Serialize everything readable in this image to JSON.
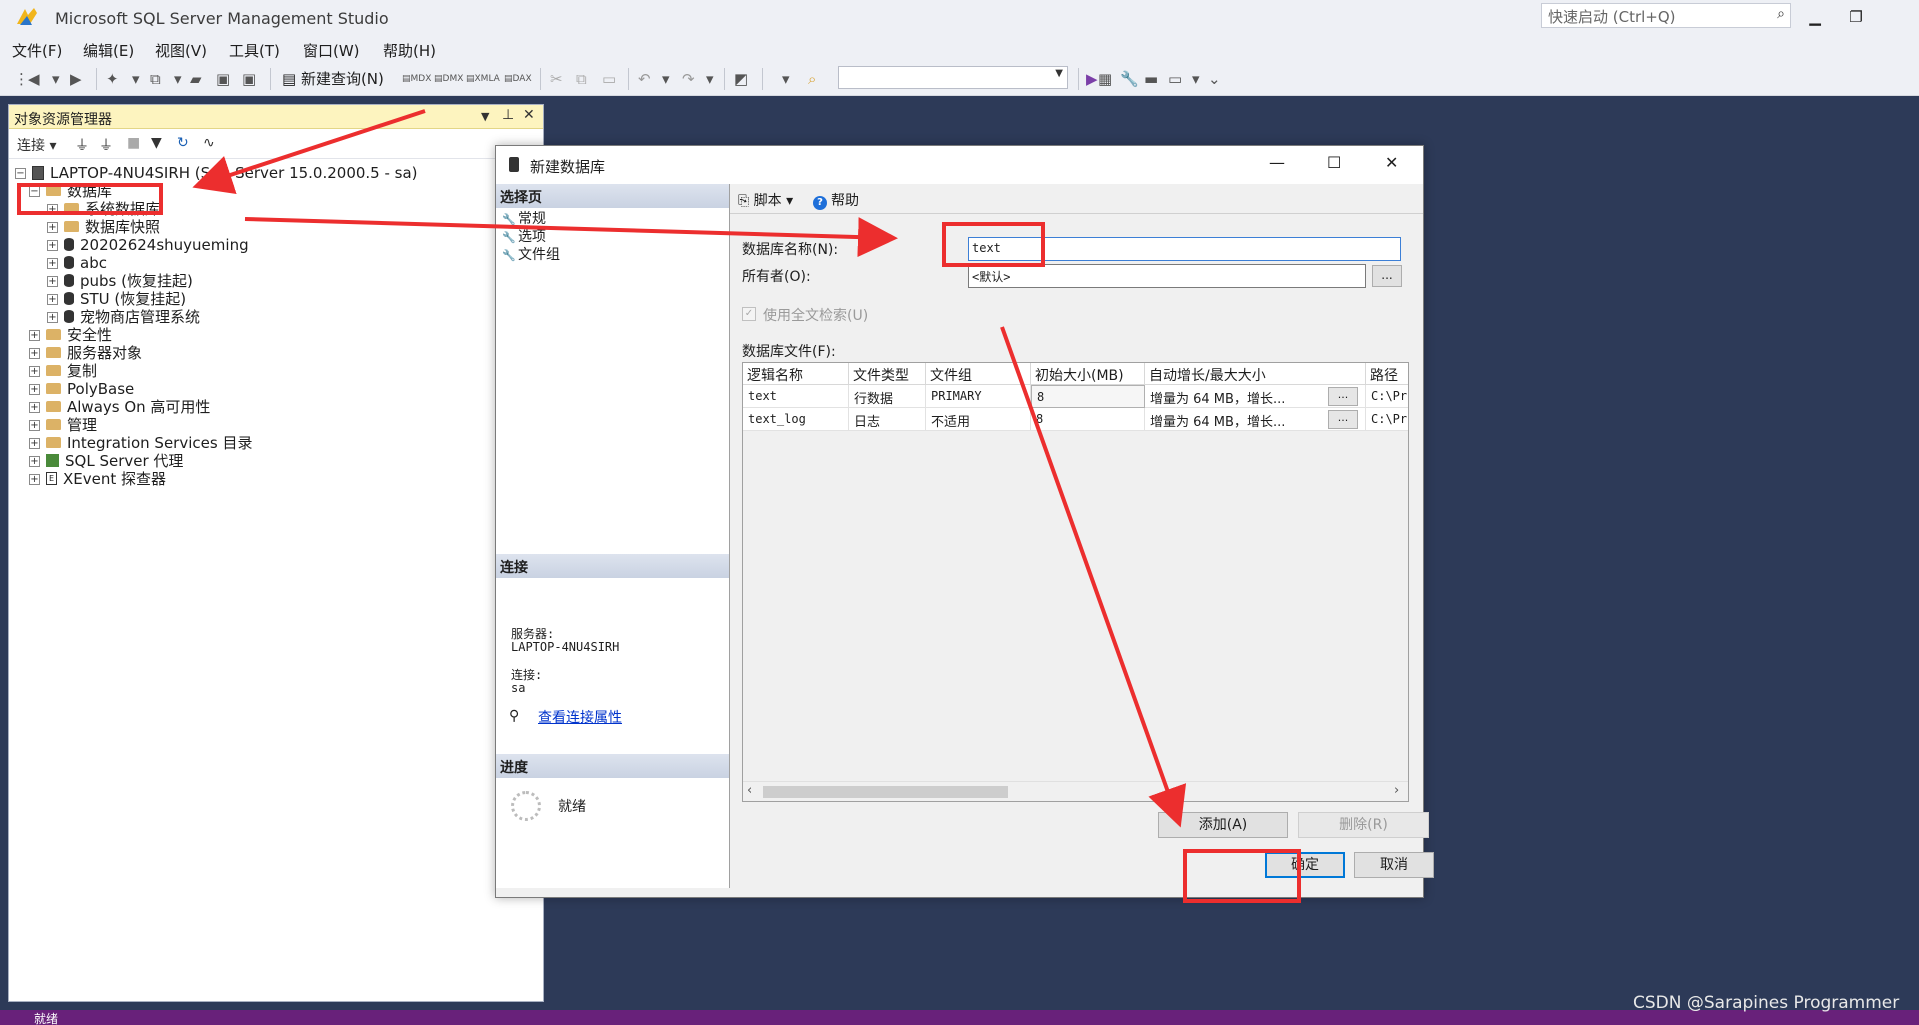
{
  "app": {
    "title": "Microsoft SQL Server Management Studio",
    "quick_launch_placeholder": "快速启动 (Ctrl+Q)",
    "icons": {
      "app": "ssms-app-icon",
      "search": "search-icon",
      "minimize": "minimize-icon",
      "restore": "restore-icon"
    }
  },
  "menu": {
    "items": [
      "文件(F)",
      "编辑(E)",
      "视图(V)",
      "工具(T)",
      "窗口(W)",
      "帮助(H)"
    ]
  },
  "toolbar": {
    "new_query": "新建查询(N)",
    "buttons": [
      "MDX",
      "DMX",
      "XMLA",
      "DAX"
    ]
  },
  "object_explorer": {
    "title": "对象资源管理器",
    "connect_label": "连接",
    "server_node": "LAPTOP-4NU4SIRH (SQL Server 15.0.2000.5 - sa)",
    "databases_node": "数据库",
    "databases": [
      "系统数据库",
      "数据库快照",
      "20202624shuyueming",
      "abc",
      "pubs (恢复挂起)",
      "STU (恢复挂起)",
      "宠物商店管理系统"
    ],
    "top_nodes": [
      "安全性",
      "服务器对象",
      "复制",
      "PolyBase",
      "Always On 高可用性",
      "管理",
      "Integration Services 目录",
      "SQL Server 代理",
      "XEvent 探查器"
    ]
  },
  "dialog": {
    "title": "新建数据库",
    "select_page_header": "选择页",
    "pages": [
      "常规",
      "选项",
      "文件组"
    ],
    "script_label": "脚本",
    "help_label": "帮助",
    "db_name_label": "数据库名称(N):",
    "db_name_value": "text",
    "owner_label": "所有者(O):",
    "owner_value": "<默认>",
    "fulltext_label": "使用全文检索(U)",
    "files_label": "数据库文件(F):",
    "files_columns": [
      "逻辑名称",
      "文件类型",
      "文件组",
      "初始大小(MB)",
      "自动增长/最大大小",
      "路径"
    ],
    "files_rows": [
      {
        "logical": "text",
        "type": "行数据",
        "group": "PRIMARY",
        "size": "8",
        "growth": "增量为 64 MB，增长...",
        "path": "C:\\Pr"
      },
      {
        "logical": "text_log",
        "type": "日志",
        "group": "不适用",
        "size": "8",
        "growth": "增量为 64 MB，增长...",
        "path": "C:\\Pr"
      }
    ],
    "ellipsis": "...",
    "connection_header": "连接",
    "server_label": "服务器:",
    "server_value": "LAPTOP-4NU4SIRH",
    "conn_label": "连接:",
    "conn_value": "sa",
    "view_conn_props": "查看连接属性",
    "progress_header": "进度",
    "progress_status": "就绪",
    "add_button": "添加(A)",
    "delete_button": "删除(R)",
    "ok_button": "确定",
    "cancel_button": "取消"
  },
  "status": {
    "text": "就绪"
  },
  "watermark": "CSDN @Sarapines Programmer",
  "colors": {
    "annotation_red": "#ec2e2e",
    "status_bar": "#68217a",
    "background": "#2d3a58",
    "oe_header": "#fdf4bf"
  }
}
